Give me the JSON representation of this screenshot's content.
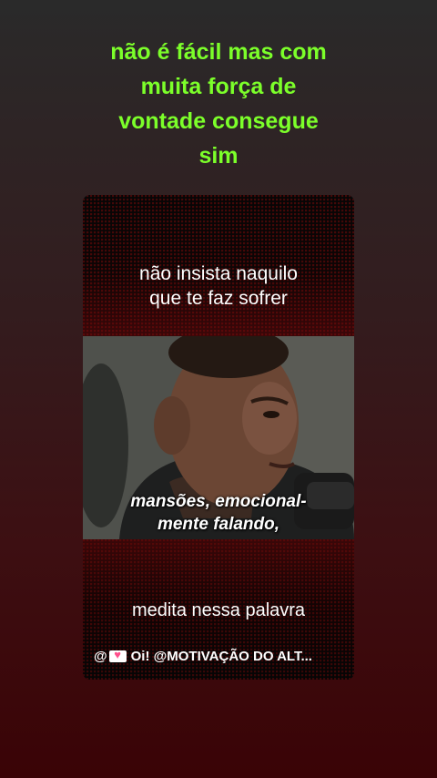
{
  "caption": {
    "lines": [
      "não é fácil mas com",
      "muita força de",
      "vontade consegue",
      "sim"
    ]
  },
  "video": {
    "top_text": [
      "não insista naquilo",
      "que te faz sofrer"
    ],
    "subtitle": [
      "mansões, emocional-",
      "mente falando,"
    ],
    "bottom_text": "medita nessa palavra",
    "attribution": {
      "at_sign": "@",
      "icon": "love-letter-icon",
      "text": "Oi! @MOTIVAÇÃO DO ALT..."
    }
  },
  "colors": {
    "caption": "#7CFF2A",
    "background_top": "#2a2a2a",
    "background_bottom": "#3a0306"
  }
}
